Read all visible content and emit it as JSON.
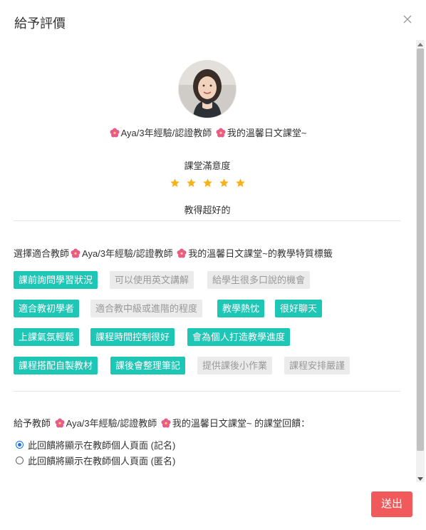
{
  "dialog": {
    "title": "給予評價",
    "close_icon": "close-icon"
  },
  "teacher": {
    "name_part1": "Aya/3年經驗/認證教師",
    "name_part2": "我的溫馨日文課堂~",
    "flower_icon": "flower-icon",
    "flower_color": "#e85b8a"
  },
  "rating": {
    "label": "課堂滿意度",
    "stars": 5,
    "max_stars": 5,
    "star_color": "#f5b21b",
    "text": "教得超好的"
  },
  "tags": {
    "heading_prefix": "選擇適合教師",
    "heading_name1": "Aya/3年經驗/認證教師",
    "heading_name2": "我的溫馨日文課堂~的教學特質標籤",
    "selected_color": "#1ec6b6",
    "items": [
      {
        "label": "課前詢問學習狀況",
        "selected": true
      },
      {
        "label": "可以使用英文講解",
        "selected": false
      },
      {
        "label": "給學生很多口說的機會",
        "selected": false
      },
      {
        "label": "適合教初學者",
        "selected": true
      },
      {
        "label": "適合教中級或進階的程度",
        "selected": false
      },
      {
        "label": "教學熱忱",
        "selected": true
      },
      {
        "label": "很好聊天",
        "selected": true
      },
      {
        "label": "上課氣氛輕鬆",
        "selected": true
      },
      {
        "label": "課程時間控制很好",
        "selected": true
      },
      {
        "label": "會為個人打造教學進度",
        "selected": true
      },
      {
        "label": "課程搭配自製教材",
        "selected": true
      },
      {
        "label": "課後會整理筆記",
        "selected": true
      },
      {
        "label": "提供課後小作業",
        "selected": false
      },
      {
        "label": "課程安排嚴謹",
        "selected": false
      }
    ]
  },
  "feedback": {
    "heading_prefix": "給予教師",
    "heading_name1": "Aya/3年經驗/認證教師",
    "heading_name2": "我的溫馨日文課堂~ 的課堂回饋：",
    "options": [
      {
        "label": "此回饋將顯示在教師個人頁面 (記名)",
        "checked": true
      },
      {
        "label": "此回饋將顯示在教師個人頁面 (匿名)",
        "checked": false
      }
    ]
  },
  "actions": {
    "submit_label": "送出",
    "submit_color": "#f05a5a"
  }
}
